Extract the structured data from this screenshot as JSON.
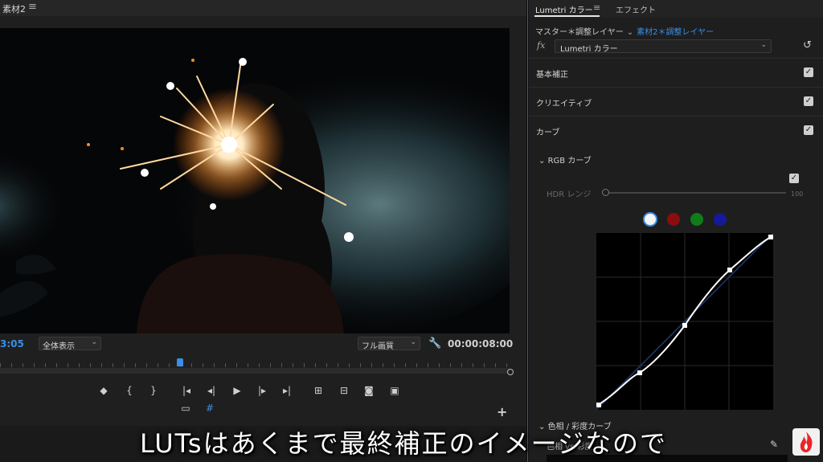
{
  "monitor": {
    "title": "素材2",
    "menu_icon": "hamburger-icon",
    "timecode_current": "3:05",
    "zoom_select": "全体表示",
    "quality_select": "フル画質",
    "timecode_duration": "00:00:08:00"
  },
  "lumetri": {
    "tab_lumetri": "Lumetri カラー",
    "tab_menu_icon": "hamburger-icon",
    "tab_effects": "エフェクト",
    "clip_master": "マスター＊調整レイヤー",
    "clip_active": "素材2＊調整レイヤー",
    "fx_label": "fx",
    "fx_effect": "Lumetri カラー",
    "sections": {
      "basic": "基本補正",
      "creative": "クリエイティブ",
      "curves": "カーブ"
    },
    "rgb_curve_label": "RGB カーブ",
    "hdr_label": "HDR レンジ",
    "hdr_value": "100",
    "channels": {
      "white": "#f4f4f4",
      "red": "#8b0d0d",
      "green": "#0f7d18",
      "blue": "#151a9a"
    },
    "hue_label": "色相 / 彩度カーブ",
    "hue_sub": "色相 vs 彩度"
  },
  "subtitle": "LUTsはあくまで最終補正のイメージなので",
  "accent_color": "#3a8ee6"
}
